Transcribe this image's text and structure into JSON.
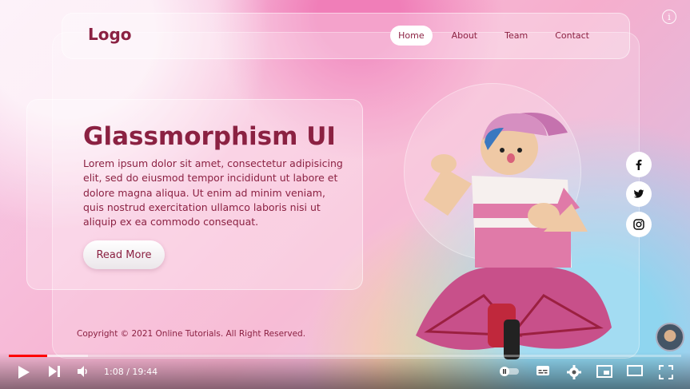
{
  "site": {
    "logo": "Logo",
    "nav": [
      {
        "label": "Home",
        "active": true
      },
      {
        "label": "About",
        "active": false
      },
      {
        "label": "Team",
        "active": false
      },
      {
        "label": "Contact",
        "active": false
      }
    ]
  },
  "hero": {
    "title": "Glassmorphism UI",
    "text": "Lorem ipsum dolor sit amet, consectetur adipisicing elit, sed do eiusmod tempor incididunt ut labore et dolore magna aliqua. Ut enim ad minim veniam, quis nostrud exercitation ullamco laboris nisi ut aliquip ex ea commodo consequat.",
    "button": "Read More"
  },
  "footer": {
    "copyright": "Copyright © 2021 Online Tutorials. All Right Reserved."
  },
  "social": [
    {
      "icon": "facebook-icon"
    },
    {
      "icon": "twitter-icon"
    },
    {
      "icon": "instagram-icon"
    }
  ],
  "player": {
    "time_display": "1:08 / 19:44",
    "played_fraction": 0.057,
    "buffered_fraction": 0.118,
    "accent": "#ff0000"
  },
  "colors": {
    "brand": "#8b2142"
  }
}
